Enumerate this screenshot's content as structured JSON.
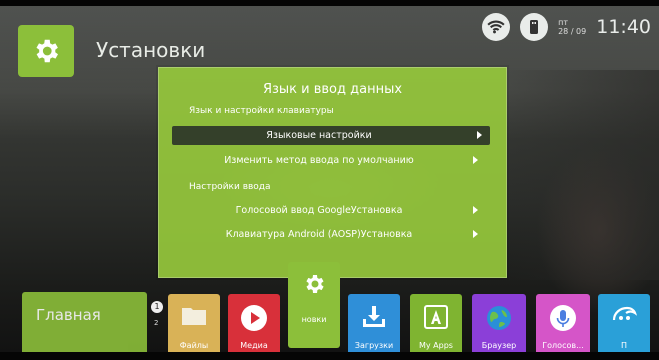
{
  "header": {
    "title": "Установки",
    "icon": "gear-icon"
  },
  "status_bar": {
    "wifi_icon": "wifi-icon",
    "usb_icon": "usb-icon",
    "day": "пт",
    "date": "28 / 09",
    "time": "11:40"
  },
  "dialog": {
    "title": "Язык и ввод данных",
    "sections": [
      {
        "title": "Язык и настройки клавиатуры",
        "items": [
          {
            "label": "Языковые настройки",
            "selected": true
          },
          {
            "label": "Изменить метод ввода по умолчанию",
            "selected": false
          }
        ]
      },
      {
        "title": "Настройки ввода",
        "items": [
          {
            "label": "Голосовой ввод GoogleУстановка",
            "selected": false
          },
          {
            "label": "Клавиатура Android (AOSP)Установка",
            "selected": false
          }
        ]
      }
    ]
  },
  "dock": {
    "home_label": "Главная",
    "badge_1": "1",
    "badge_2": "2",
    "tiles": [
      {
        "id": "files",
        "label": "Файлы",
        "icon": "folder-icon",
        "color": "#d9b257"
      },
      {
        "id": "media",
        "label": "Медиа",
        "icon": "play-icon",
        "color": "#d8303a"
      },
      {
        "id": "settings",
        "label": "новки",
        "icon": "gear-icon",
        "color": "#8cbf3a"
      },
      {
        "id": "downloads",
        "label": "Загрузки",
        "icon": "download-icon",
        "color": "#2f8fd8"
      },
      {
        "id": "myapps",
        "label": "My Apps",
        "icon": "apps-icon",
        "color": "#7fb431"
      },
      {
        "id": "browser",
        "label": "Браузер",
        "icon": "globe-icon",
        "color": "#8b3fd8"
      },
      {
        "id": "voice",
        "label": "Голосов...",
        "icon": "microphone-icon",
        "color": "#d555c8"
      },
      {
        "id": "extra",
        "label": "П",
        "icon": "app-icon",
        "color": "#2aa0d8"
      }
    ]
  }
}
